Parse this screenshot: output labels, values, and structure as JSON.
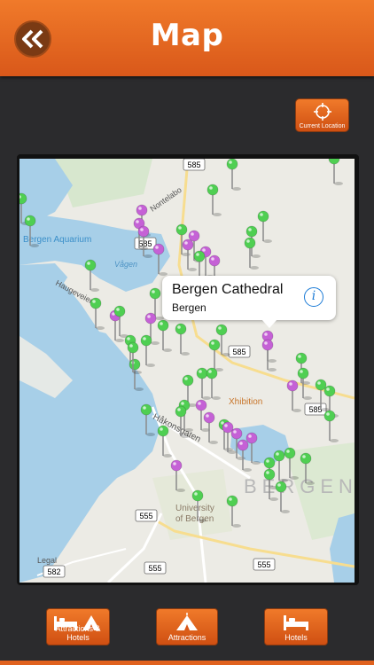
{
  "header": {
    "title": "Map",
    "back_icon": "double-chevron-left-icon"
  },
  "current_location": {
    "label": "Current Location",
    "icon": "crosshair-icon"
  },
  "map": {
    "labels": {
      "aquarium": "Bergen Aquarium",
      "vagen": "Vågen",
      "haugeveien": "Haugeveien",
      "nontelabo": "Nontelabo",
      "hakonsgaten": "Håkonsgaten",
      "xhibition": "Xhibition",
      "city": "BERGEN",
      "university_1": "University",
      "university_2": "of Bergen",
      "legal": "Legal",
      "route_1": "585",
      "route_2": "585",
      "route_3": "585",
      "route_4": "585",
      "route_5": "555",
      "route_6": "555",
      "route_7": "555",
      "route_8": "582"
    },
    "callout": {
      "title": "Bergen Cathedral",
      "subtitle": "Bergen",
      "info_icon": "info-icon"
    }
  },
  "tabs": [
    {
      "label": "Attractions & Hotels",
      "icon": "bed-and-tent-icon"
    },
    {
      "label": "Attractions",
      "icon": "tent-icon"
    },
    {
      "label": "Hotels",
      "icon": "bed-icon"
    }
  ],
  "colors": {
    "accent": "#e8692a",
    "pin_green": "#4fcf52",
    "pin_purple": "#c561d6",
    "water": "#a7cfe8"
  }
}
